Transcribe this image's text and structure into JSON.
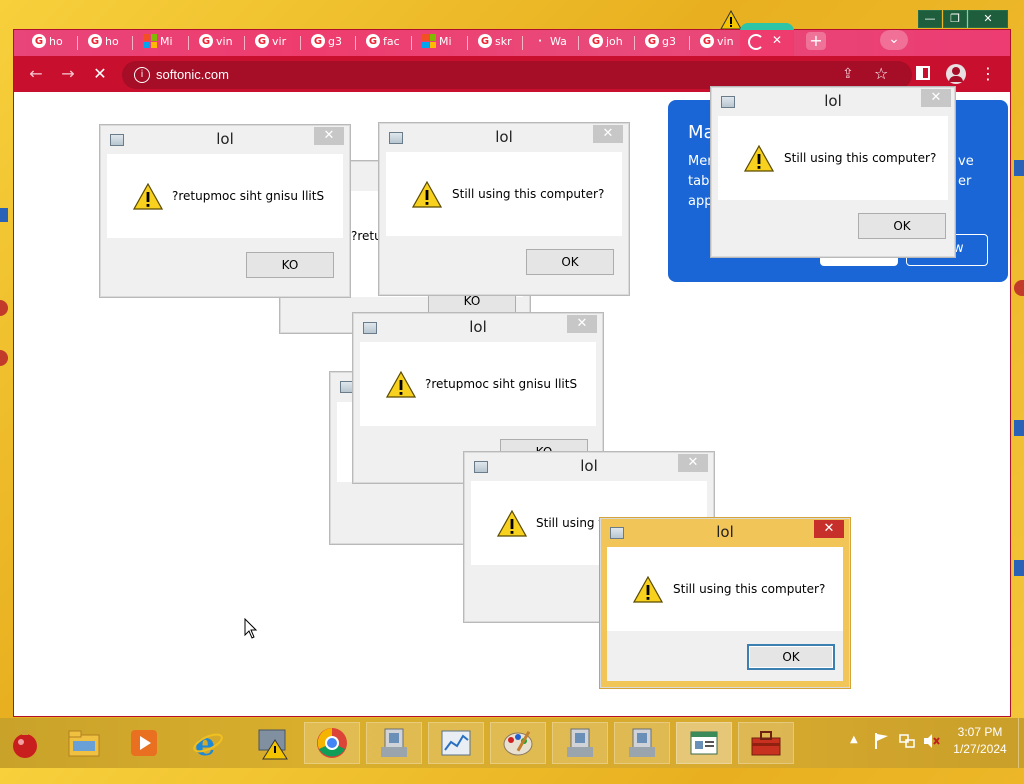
{
  "browser": {
    "tabs": [
      {
        "label": "ho",
        "favicon": "google-icon"
      },
      {
        "label": "ho",
        "favicon": "google-icon"
      },
      {
        "label": "Mi",
        "favicon": "microsoft-icon"
      },
      {
        "label": "vin",
        "favicon": "google-icon"
      },
      {
        "label": "vir",
        "favicon": "google-icon"
      },
      {
        "label": "g3",
        "favicon": "google-icon"
      },
      {
        "label": "fac",
        "favicon": "google-icon"
      },
      {
        "label": "Mi",
        "favicon": "microsoft-icon"
      },
      {
        "label": "skr",
        "favicon": "google-icon"
      },
      {
        "label": "Wa",
        "favicon": "generic-icon"
      },
      {
        "label": "joh",
        "favicon": "google-icon"
      },
      {
        "label": "g3",
        "favicon": "google-icon"
      },
      {
        "label": "vin",
        "favicon": "google-icon"
      }
    ],
    "address": "softonic.com",
    "new_tab_glyph": "+",
    "close_tab_glyph": "✕",
    "tab_search_glyph": "⌄"
  },
  "promo": {
    "title": "Ma",
    "lines": [
      "Mer",
      "tabs",
      "app"
    ],
    "right_fragments": [
      "ve",
      "er"
    ],
    "button_label": "w"
  },
  "dialogs": [
    {
      "title": "lol",
      "message": "?retupmoc siht gnisu llitS",
      "button": "KO"
    },
    {
      "title": "lol",
      "message": "Still using this computer?",
      "button": "OK"
    },
    {
      "title": "lol",
      "message": "Still using this computer?",
      "button": "OK"
    },
    {
      "title": "lol",
      "message": "?retupmoc siht gnisu llitS",
      "button": "KO"
    },
    {
      "title": "lol",
      "message": "Still using th",
      "button": ""
    },
    {
      "title": "lol",
      "message": "Still using this computer?",
      "button": "OK"
    }
  ],
  "hidden_dialog_fragments": {
    "retu": "?retu",
    "ko1": "KO",
    "ko2": "KO"
  },
  "taskbar": {
    "time": "3:07 PM",
    "date": "1/27/2024",
    "icons": [
      "christmas-ornament-icon",
      "file-explorer-icon",
      "media-player-icon",
      "internet-explorer-icon",
      "app-warning-icon",
      "chrome-icon",
      "installer-icon",
      "chart-window-icon",
      "paint-icon",
      "installer-icon",
      "installer-icon",
      "dialog-window-icon",
      "toolbox-icon"
    ]
  },
  "colors": {
    "browser_frame": "#c8102e",
    "tabstrip": "#ee3c6e",
    "promo": "#1a66d6",
    "active_dialog": "#f2c558",
    "close_active": "#c7302a",
    "desktop": "#f4c63a"
  }
}
